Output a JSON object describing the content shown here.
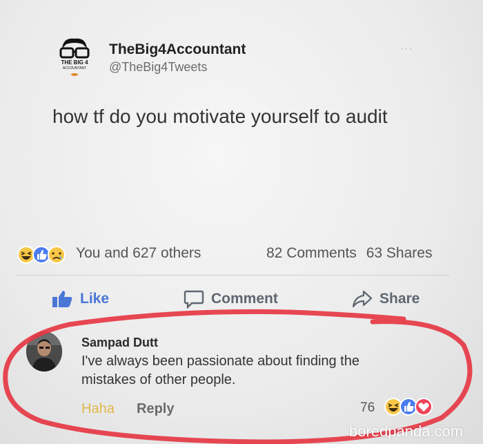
{
  "post": {
    "author_name": "TheBig4Accountant",
    "author_handle": "@TheBig4Tweets",
    "logo_text_1": "THE BIG 4",
    "logo_text_2": "ACCOUNTANT",
    "more": "···",
    "text": "how tf do you motivate yourself to audit"
  },
  "stats": {
    "reactions_text": "You and 627 others",
    "comments": "82 Comments",
    "shares": "63 Shares"
  },
  "actions": {
    "like": "Like",
    "comment": "Comment",
    "share": "Share"
  },
  "comment": {
    "name": "Sampad Dutt",
    "line1": "I've always been passionate about finding the",
    "line2": "mistakes of other people.",
    "haha": "Haha",
    "reply": "Reply",
    "reaction_count": "76"
  },
  "watermark": "boredpanda.com",
  "colors": {
    "like_blue": "#4a76d6",
    "highlight_red": "#e53844",
    "haha_yellow": "#f7c646",
    "love_red": "#f0445a"
  },
  "icons": [
    "logo-icon",
    "haha-reaction-icon",
    "like-reaction-icon",
    "sad-reaction-icon",
    "thumbs-up-icon",
    "comment-icon",
    "share-arrow-icon",
    "love-reaction-icon"
  ]
}
